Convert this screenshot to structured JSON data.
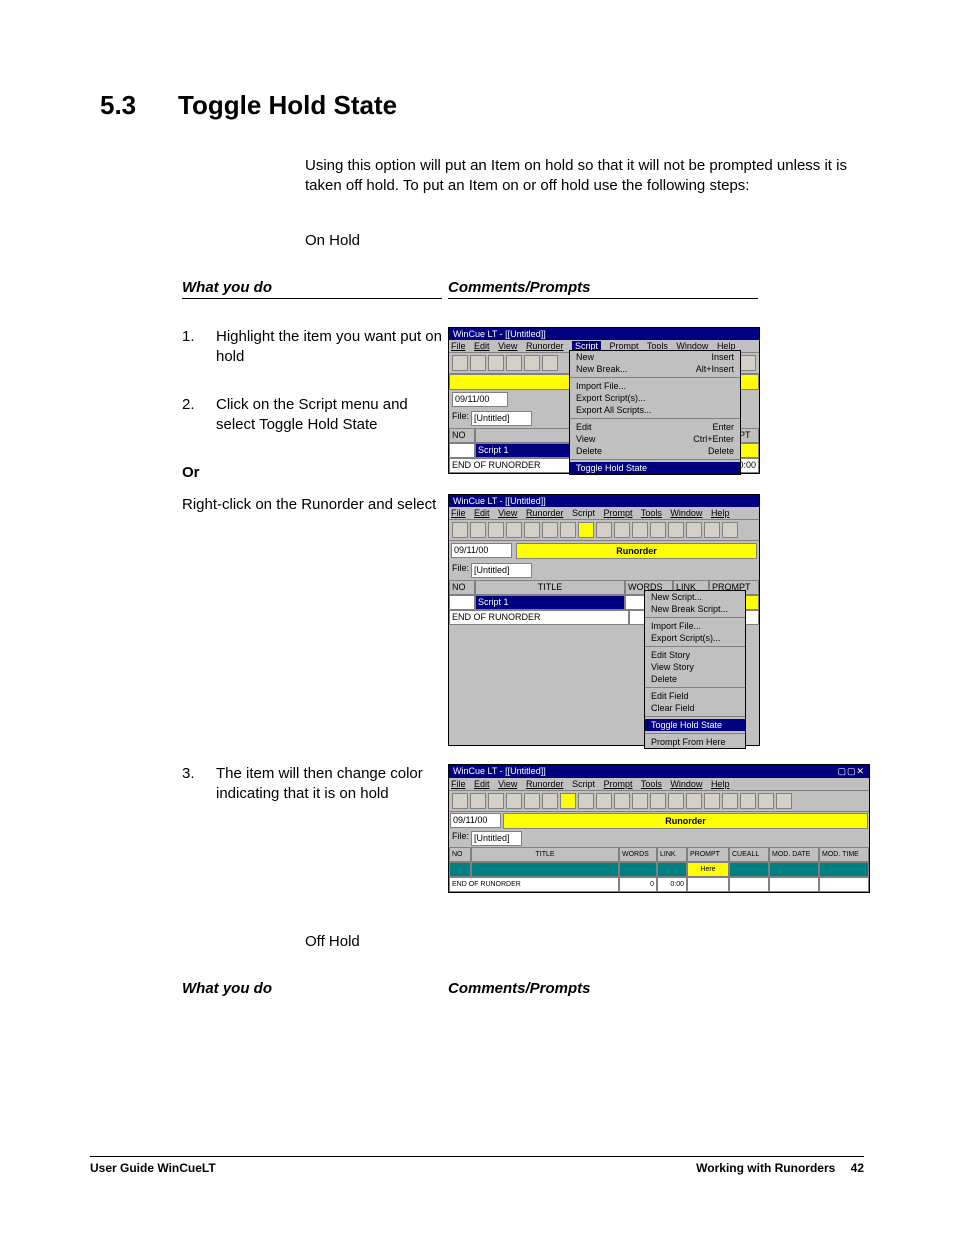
{
  "section": {
    "number": "5.3",
    "title": "Toggle Hold State",
    "intro": "Using this option will put an Item on hold so that it will not be prompted unless it is taken off hold. To put an Item on or off hold use the following steps:",
    "onhold_label": "On Hold",
    "offhold_label": "Off Hold"
  },
  "columns": {
    "left_heading": "What you do",
    "right_heading": "Comments/Prompts"
  },
  "steps": {
    "s1_num": "1.",
    "s1_text": "Highlight the item you want put on hold",
    "s2_num": "2.",
    "s2_text": "Click on the Script menu and select Toggle Hold State",
    "or_label": "Or",
    "rc_text": "Right-click on the Runorder and select",
    "s3_num": "3.",
    "s3_text": "The item will then change color indicating that it is on hold"
  },
  "shot_common": {
    "app_title": "WinCue LT - [[Untitled]]",
    "menus": {
      "file": "File",
      "edit": "Edit",
      "view": "View",
      "runorder": "Runorder",
      "script": "Script",
      "prompt": "Prompt",
      "tools": "Tools",
      "window": "Window",
      "help": "Help"
    },
    "date": "09/11/00",
    "file_label": "File:",
    "file_value": "[Untitled]",
    "table_headers": {
      "no": "NO",
      "title": "TITLE",
      "words": "WORDS",
      "link": "LINK",
      "prompt": "PROMPT",
      "cueall": "CUEALL",
      "mod_date": "MOD. DATE",
      "mod_time": "MOD. TIME"
    },
    "script1": "Script 1",
    "end_row": "END OF RUNORDER",
    "zero": "0",
    "zzz": "0:00",
    "here": "Here",
    "runorder_label": "Runorder"
  },
  "shot1": {
    "menu_items": {
      "new": "New",
      "new_shortcut": "Insert",
      "new_break": "New Break...",
      "new_break_shortcut": "Alt+Insert",
      "import_file": "Import File...",
      "export_scripts": "Export Script(s)...",
      "export_all": "Export All Scripts...",
      "edit": "Edit",
      "edit_shortcut": "Enter",
      "view": "View",
      "view_shortcut": "Ctrl+Enter",
      "delete": "Delete",
      "delete_shortcut": "Delete",
      "toggle": "Toggle Hold State"
    }
  },
  "shot2": {
    "context_items": {
      "new_script": "New Script...",
      "new_break": "New Break Script...",
      "import_file": "Import File...",
      "export_scripts": "Export Script(s)...",
      "edit_story": "Edit Story",
      "view_story": "View Story",
      "delete": "Delete",
      "edit_field": "Edit Field",
      "clear_field": "Clear Field",
      "toggle": "Toggle Hold State",
      "prompt_from_here": "Prompt From Here"
    }
  },
  "footer": {
    "left": "User Guide WinCueLT",
    "right": "Working with Runorders",
    "page": "42"
  }
}
